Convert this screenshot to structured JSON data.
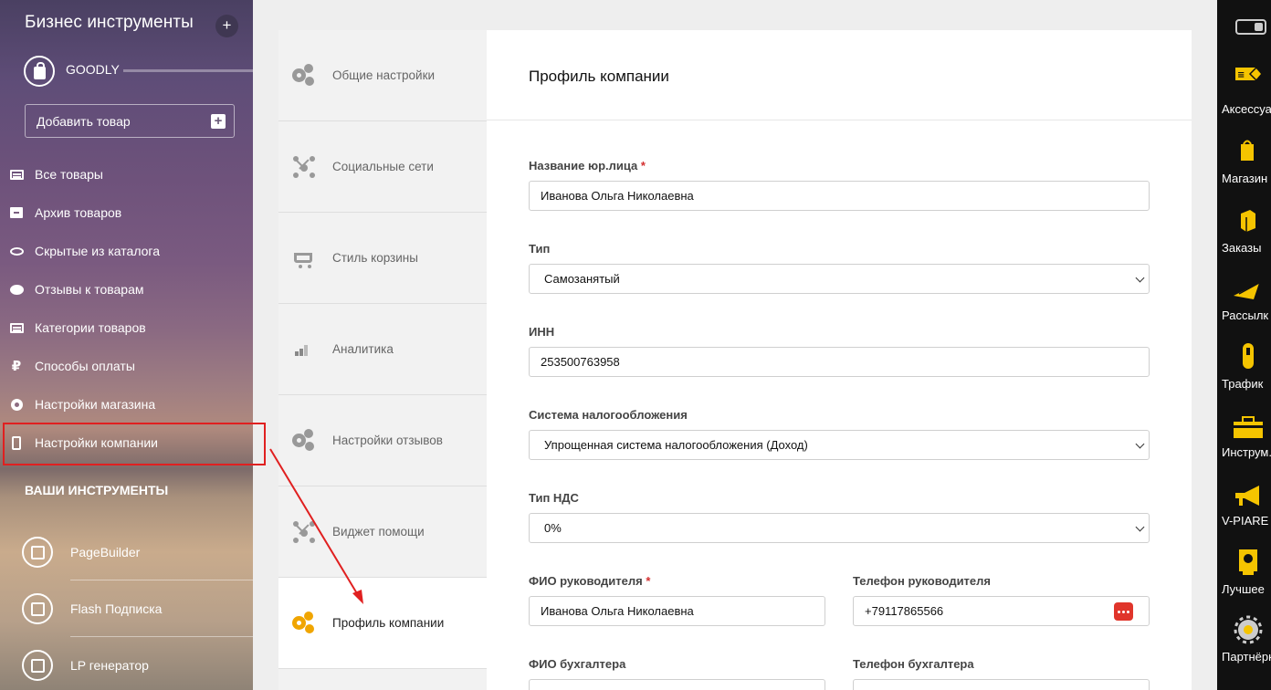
{
  "sidebar": {
    "title": "Бизнес инструменты",
    "plus": "+",
    "shop_name": "GOODLY",
    "add_product": "Добавить товар",
    "items": [
      {
        "label": "Все товары"
      },
      {
        "label": "Архив товаров"
      },
      {
        "label": "Скрытые из каталога"
      },
      {
        "label": "Отзывы к товарам"
      },
      {
        "label": "Категории товаров"
      },
      {
        "label": "Способы оплаты"
      },
      {
        "label": "Настройки магазина"
      },
      {
        "label": "Настройки компании"
      }
    ],
    "ruble_symbol": "₽",
    "tools_title": "ВАШИ ИНСТРУМЕНТЫ",
    "tools": [
      {
        "label": "PageBuilder"
      },
      {
        "label": "Flash Подписка"
      },
      {
        "label": "LP генератор"
      }
    ]
  },
  "tabs": [
    {
      "label": "Общие настройки",
      "icon": "gears-icon"
    },
    {
      "label": "Социальные сети",
      "icon": "network-icon"
    },
    {
      "label": "Стиль корзины",
      "icon": "cart-icon"
    },
    {
      "label": "Аналитика",
      "icon": "bar-chart-icon"
    },
    {
      "label": "Настройки отзывов",
      "icon": "gears-icon"
    },
    {
      "label": "Виджет помощи",
      "icon": "network-icon"
    },
    {
      "label": "Профиль компании",
      "icon": "gears-icon",
      "active": true
    }
  ],
  "main": {
    "title": "Профиль компании",
    "required_mark": "*",
    "fields": {
      "legal_name": {
        "label": "Название юр.лица",
        "value": "Иванова Ольга Николаевна"
      },
      "type": {
        "label": "Тип",
        "value": "Самозанятый"
      },
      "inn": {
        "label": "ИНН",
        "value": "253500763958"
      },
      "tax_system": {
        "label": "Система налогообложения",
        "value": "Упрощенная система налогообложения (Доход)"
      },
      "vat_type": {
        "label": "Тип НДС",
        "value": "0%"
      },
      "director_name": {
        "label": "ФИО руководителя",
        "value": "Иванова Ольга Николаевна"
      },
      "director_phone": {
        "label": "Телефон руководителя",
        "value": "+79117865566"
      },
      "accountant_name": {
        "label": "ФИО бухгалтера",
        "value": ""
      },
      "accountant_phone": {
        "label": "Телефон бухгалтера",
        "value": ""
      }
    }
  },
  "rightbar": {
    "items": [
      {
        "label": "Аксессуа",
        "icon": "accessories-icon"
      },
      {
        "label": "Магазин",
        "icon": "shop-bag-icon"
      },
      {
        "label": "Заказы",
        "icon": "orders-icon"
      },
      {
        "label": "Рассылк",
        "icon": "mailing-icon"
      },
      {
        "label": "Трафик",
        "icon": "traffic-icon"
      },
      {
        "label": "Инструм.",
        "icon": "toolbox-icon"
      },
      {
        "label": "V-PIARE",
        "icon": "megaphone-icon"
      },
      {
        "label": "Лучшее",
        "icon": "best-icon"
      },
      {
        "label": "Партнёрк",
        "icon": "partner-gear-icon"
      }
    ]
  },
  "colors": {
    "accent_orange": "#f0a500",
    "highlight_red": "#e02020",
    "danger_button": "#e0352b"
  }
}
